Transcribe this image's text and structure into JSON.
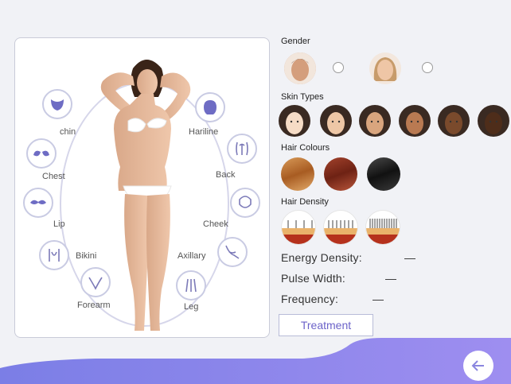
{
  "zones": {
    "chin": "chin",
    "hairline": "Hariline",
    "chest": "Chest",
    "back": "Back",
    "lip": "Lip",
    "cheek": "Cheek",
    "bikini": "Bikini",
    "axillary": "Axillary",
    "forearm": "Forearm",
    "leg": "Leg"
  },
  "sections": {
    "gender": "Gender",
    "skin_types": "Skin Types",
    "hair_colours": "Hair Colours",
    "hair_density": "Hair Density"
  },
  "params": {
    "energy_label": "Energy Density:",
    "energy_value": "—",
    "pulse_label": "Pulse Width:",
    "pulse_value": "—",
    "frequency_label": "Frequency:",
    "frequency_value": "—"
  },
  "treatment_button": "Treatment",
  "colors": {
    "accent": "#6c63c9",
    "footer_gradient_start": "#7b7ee6",
    "footer_gradient_end": "#9e8ef0"
  },
  "skin_tones": [
    "#f6dcc6",
    "#eec7a6",
    "#d9a57e",
    "#b97a52",
    "#7a4a2c",
    "#4e2d1a"
  ],
  "hair_colors": [
    "#b36a2a",
    "#8a2f1c",
    "#1f1f1f"
  ]
}
